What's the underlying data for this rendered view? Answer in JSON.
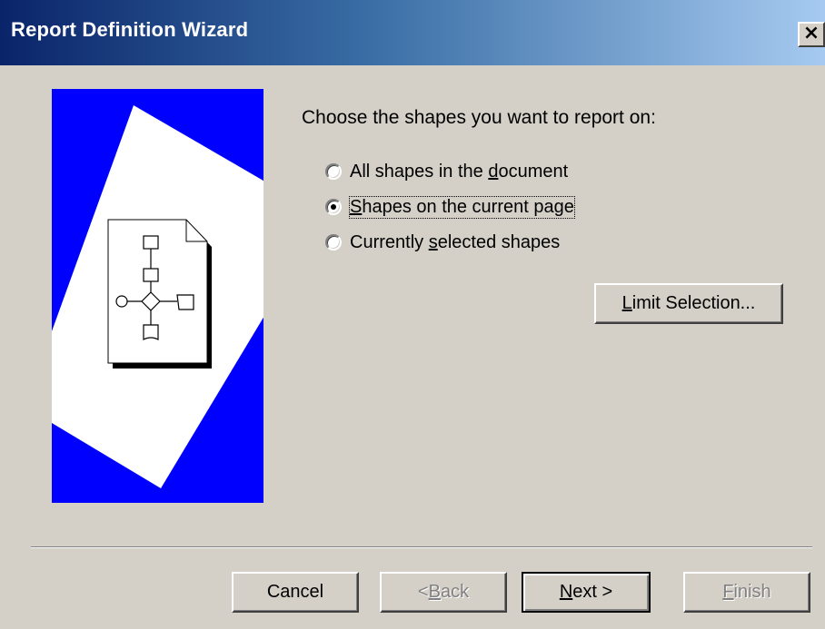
{
  "window": {
    "title": "Report Definition Wizard",
    "close_glyph": "×"
  },
  "prompt": "Choose the shapes you want to report on:",
  "options": [
    {
      "pre": "All shapes in the ",
      "key": "d",
      "post": "ocument",
      "checked": false
    },
    {
      "pre": "",
      "key": "S",
      "post": "hapes on the current page",
      "checked": true
    },
    {
      "pre": "Currently ",
      "key": "s",
      "post": "elected shapes",
      "checked": false
    }
  ],
  "limit_button": {
    "key": "L",
    "post": "imit Selection..."
  },
  "buttons": {
    "cancel": "Cancel",
    "back": {
      "pre": "< ",
      "key": "B",
      "post": "ack",
      "disabled": true
    },
    "next": {
      "key": "N",
      "post": "ext >",
      "default": true
    },
    "finish": {
      "key": "F",
      "post": "inish",
      "disabled": true
    }
  },
  "colors": {
    "dialog_bg": "#d4d0c8",
    "title_start": "#0a246a",
    "title_end": "#a6caf0",
    "art_bg": "#0000ff"
  },
  "icons": {
    "close": "close-icon",
    "illustration": "flowchart-document-illustration"
  }
}
